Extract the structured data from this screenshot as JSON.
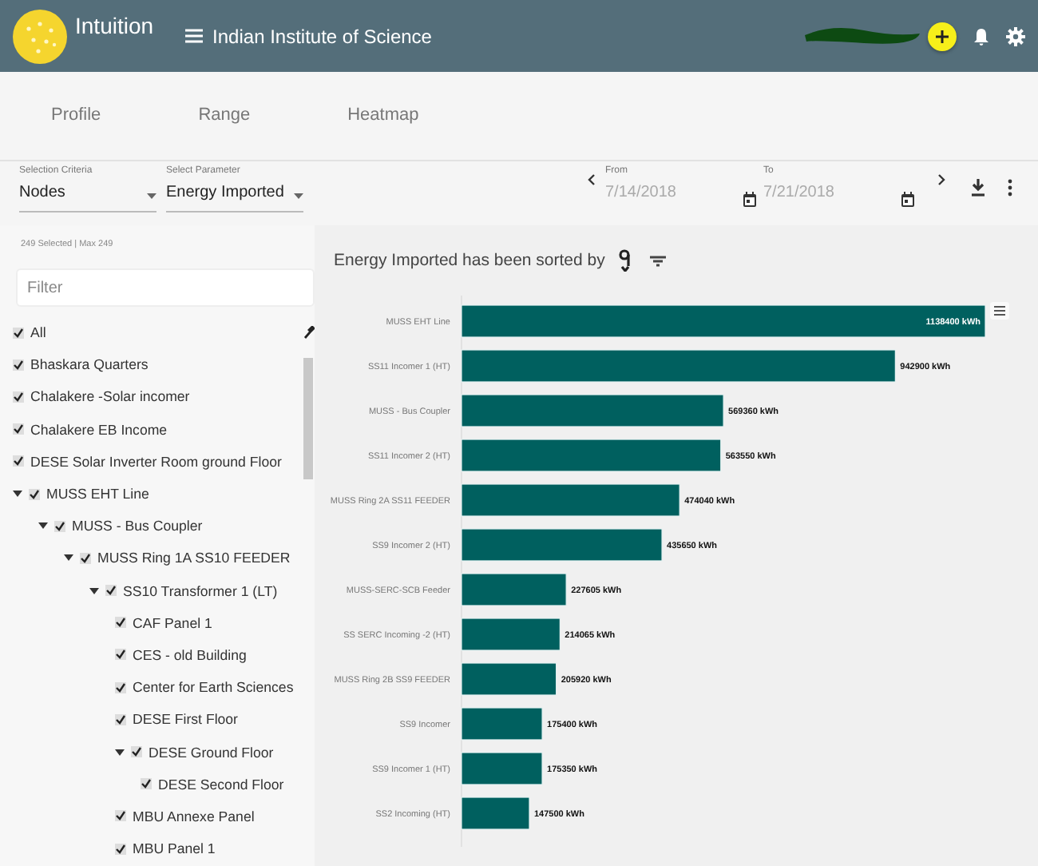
{
  "header": {
    "app_name": "Intuition",
    "organization": "Indian Institute of Science"
  },
  "tabs": [
    {
      "label": "Profile",
      "selected": false
    },
    {
      "label": "Range",
      "selected": false
    },
    {
      "label": "Heatmap",
      "selected": false
    }
  ],
  "selection_criteria": {
    "label": "Selection Criteria",
    "value": "Nodes"
  },
  "select_parameter": {
    "label": "Select Parameter",
    "value": "Energy Imported"
  },
  "date_range": {
    "from_label": "From",
    "from_value": "7/14/2018",
    "to_label": "To",
    "to_value": "7/21/2018"
  },
  "sidebar": {
    "selection_count": "249 Selected | Max 249",
    "filter_placeholder": "Filter",
    "select_all": {
      "label": "All",
      "checked": true
    },
    "tree": [
      {
        "label": "Bhaskara Quarters",
        "checked": true
      },
      {
        "label": "Chalakere -Solar incomer",
        "checked": true
      },
      {
        "label": "Chalakere EB Income",
        "checked": true
      },
      {
        "label": "DESE Solar Inverter Room ground Floor",
        "checked": true
      },
      {
        "label": "MUSS EHT Line",
        "checked": true,
        "expanded": true,
        "children": [
          {
            "label": "MUSS - Bus Coupler",
            "checked": true,
            "expanded": true,
            "children": [
              {
                "label": "MUSS Ring 1A SS10 FEEDER",
                "checked": true,
                "expanded": true,
                "children": [
                  {
                    "label": "SS10 Transformer 1 (LT)",
                    "checked": true,
                    "expanded": true,
                    "children": [
                      {
                        "label": "CAF Panel 1",
                        "checked": true
                      },
                      {
                        "label": "CES - old Building",
                        "checked": true
                      },
                      {
                        "label": "Center for Earth Sciences",
                        "checked": true
                      },
                      {
                        "label": "DESE First Floor",
                        "checked": true
                      },
                      {
                        "label": "DESE Ground Floor",
                        "checked": true,
                        "expanded": true,
                        "children": [
                          {
                            "label": "DESE Second Floor",
                            "checked": true
                          }
                        ]
                      },
                      {
                        "label": "MBU Annexe Panel",
                        "checked": true
                      },
                      {
                        "label": "MBU Panel 1",
                        "checked": true
                      }
                    ]
                  }
                ]
              }
            ]
          }
        ]
      }
    ]
  },
  "chart": {
    "title": "Energy Imported has been sorted by",
    "chart_data": {
      "type": "bar",
      "orientation": "horizontal",
      "categories": [
        "MUSS EHT Line",
        "SS11 Incomer 1 (HT)",
        "MUSS - Bus Coupler",
        "SS11 Incomer 2 (HT)",
        "MUSS Ring 2A SS11 FEEDER",
        "SS9 Incomer 2 (HT)",
        "MUSS-SERC-SCB Feeder",
        "SS SERC Incoming -2 (HT)",
        "MUSS Ring 2B SS9 FEEDER",
        "SS9 Incomer",
        "SS9 Incomer 1 (HT)",
        "SS2 Incoming (HT)"
      ],
      "series": [
        {
          "color": "#00605f",
          "value_labels": [
            "1138400 kWh",
            "942900 kWh",
            "569360 kWh",
            "563550 kWh",
            "474040 kWh",
            "435650 kWh",
            "227605 kWh",
            "214065 kWh",
            "205920 kWh",
            "175400 kWh",
            "175350 kWh",
            "147500 kWh"
          ],
          "values": [
            1138400,
            942900,
            569360,
            563550,
            474040,
            435650,
            227605,
            214065,
            205920,
            175400,
            175350,
            147500
          ]
        }
      ]
    }
  }
}
